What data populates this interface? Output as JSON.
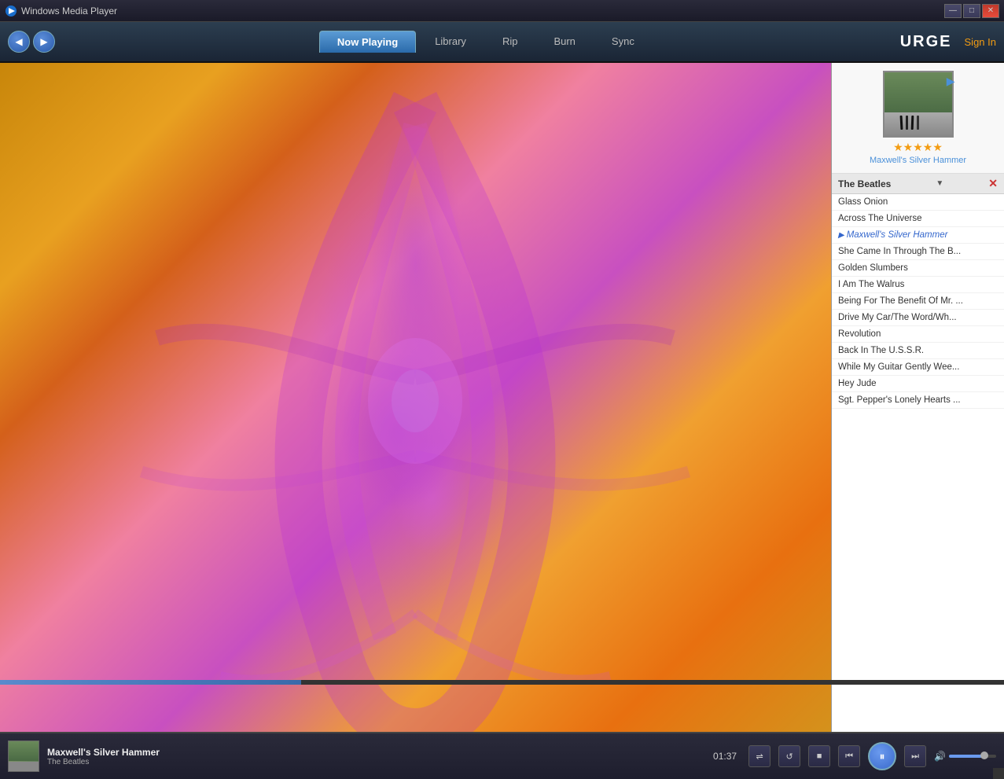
{
  "window": {
    "title": "Windows Media Player",
    "titlebar_icon": "▶"
  },
  "titlebar": {
    "minimize_label": "—",
    "maximize_label": "□",
    "close_label": "✕"
  },
  "nav": {
    "back_label": "◀",
    "forward_label": "▶",
    "tabs": [
      {
        "id": "now-playing",
        "label": "Now Playing",
        "active": true
      },
      {
        "id": "library",
        "label": "Library",
        "active": false
      },
      {
        "id": "rip",
        "label": "Rip",
        "active": false
      },
      {
        "id": "burn",
        "label": "Burn",
        "active": false
      },
      {
        "id": "sync",
        "label": "Sync",
        "active": false
      }
    ],
    "urge_label": "URGE",
    "sign_in_label": "Sign In"
  },
  "album": {
    "title": "Maxwell's Silver Hammer",
    "artist": "The Beatles",
    "stars": "★★★★★",
    "dropdown_label": "▼",
    "close_label": "✕"
  },
  "playlist": {
    "artist": "The Beatles",
    "now_playing_song": "Maxwell's Silver Hammer",
    "songs": [
      {
        "title": "Glass Onion",
        "playing": false
      },
      {
        "title": "Across The Universe",
        "playing": false
      },
      {
        "title": "Maxwell's Silver Hammer",
        "playing": true
      },
      {
        "title": "She Came In Through The B...",
        "playing": false
      },
      {
        "title": "Golden Slumbers",
        "playing": false
      },
      {
        "title": "I Am The Walrus",
        "playing": false
      },
      {
        "title": "Being For The Benefit Of Mr. ...",
        "playing": false
      },
      {
        "title": "Drive My Car/The Word/Wh...",
        "playing": false
      },
      {
        "title": "Revolution",
        "playing": false
      },
      {
        "title": "Back In The U.S.S.R.",
        "playing": false
      },
      {
        "title": "While My Guitar Gently Wee...",
        "playing": false
      },
      {
        "title": "Hey Jude",
        "playing": false
      },
      {
        "title": "Sgt. Pepper's Lonely Hearts ...",
        "playing": false
      }
    ]
  },
  "controls": {
    "time": "01:37",
    "shuffle_label": "⇌",
    "repeat_label": "↺",
    "stop_label": "■",
    "prev_label": "⏮",
    "play_pause_label": "⏸",
    "next_label": "⏭",
    "volume_icon_label": "🔊",
    "track_name": "Maxwell's Silver Hammer",
    "track_sub": "The Beatles"
  }
}
